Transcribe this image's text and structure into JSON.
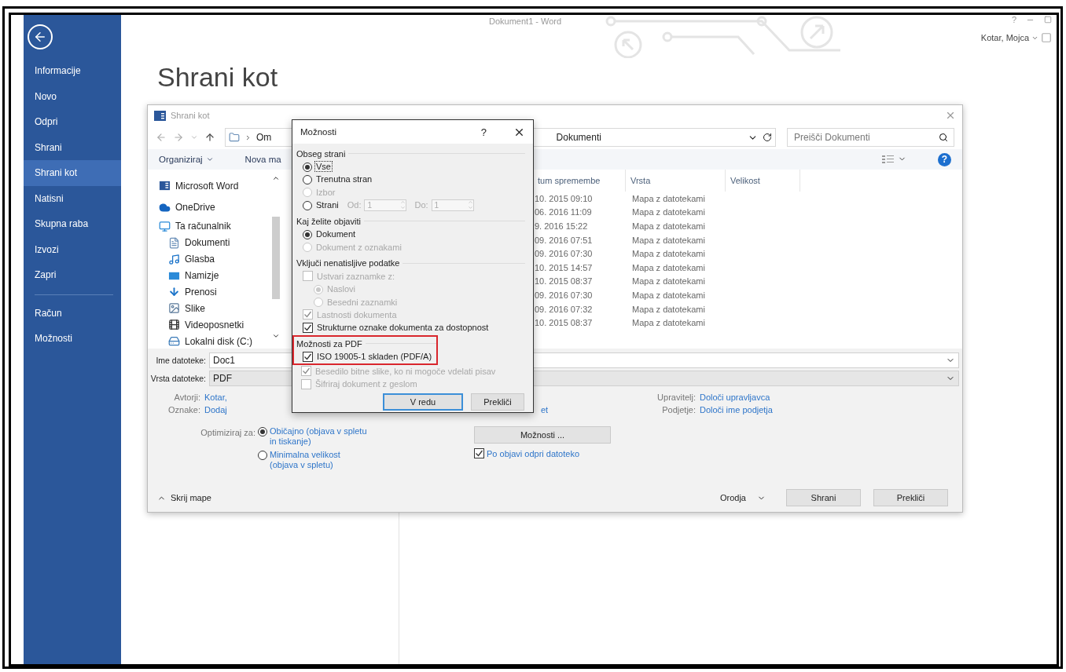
{
  "window": {
    "title": "Dokument1 - Word",
    "help": "?",
    "account": "Kotar, Mojca"
  },
  "backstage_nav": {
    "sections": [
      {
        "items": [
          {
            "label": "Informacije",
            "selected": false
          },
          {
            "label": "Novo",
            "selected": false
          },
          {
            "label": "Odpri",
            "selected": false
          },
          {
            "label": "Shrani",
            "selected": false
          },
          {
            "label": "Shrani kot",
            "selected": true
          },
          {
            "label": "Natisni",
            "selected": false
          },
          {
            "label": "Skupna raba",
            "selected": false
          },
          {
            "label": "Izvozi",
            "selected": false
          },
          {
            "label": "Zapri",
            "selected": false
          }
        ]
      },
      {
        "items": [
          {
            "label": "Račun",
            "selected": false
          },
          {
            "label": "Možnosti",
            "selected": false
          }
        ]
      }
    ]
  },
  "heading": "Shrani kot",
  "save_dialog": {
    "title": "Shrani kot",
    "breadcrumb": [
      "Om",
      "Dokumenti"
    ],
    "search": {
      "placeholder": "Preišči Dokumenti"
    },
    "toolbar": {
      "organize": "Organiziraj",
      "new_folder": "Nova ma",
      "help": "?"
    },
    "nav_pane": [
      {
        "label": "Microsoft Word"
      },
      {
        "label": "OneDrive"
      },
      {
        "label": "Ta računalnik",
        "children": [
          {
            "label": "Dokumenti"
          },
          {
            "label": "Glasba"
          },
          {
            "label": "Namizje"
          },
          {
            "label": "Prenosi"
          },
          {
            "label": "Slike"
          },
          {
            "label": "Videoposnetki"
          },
          {
            "label": "Lokalni disk (C:)"
          }
        ]
      }
    ],
    "columns": [
      "tum spremembe",
      "Vrsta",
      "Velikost"
    ],
    "rows": [
      {
        "date": "10. 2015 09:10",
        "type": "Mapa z datotekami"
      },
      {
        "date": "06. 2016 11:09",
        "type": "Mapa z datotekami"
      },
      {
        "date": "9. 2016 15:22",
        "type": "Mapa z datotekami"
      },
      {
        "date": "09. 2016 07:51",
        "type": "Mapa z datotekami"
      },
      {
        "date": "09. 2016 07:30",
        "type": "Mapa z datotekami"
      },
      {
        "date": "10. 2015 14:57",
        "type": "Mapa z datotekami"
      },
      {
        "date": "10. 2015 08:37",
        "type": "Mapa z datotekami"
      },
      {
        "date": "09. 2016 07:30",
        "type": "Mapa z datotekami"
      },
      {
        "date": "09. 2016 07:32",
        "type": "Mapa z datotekami"
      },
      {
        "date": "10. 2015 08:37",
        "type": "Mapa z datotekami"
      }
    ],
    "file_name": {
      "label": "Ime datoteke:",
      "value": "Doc1"
    },
    "file_type": {
      "label": "Vrsta datoteke:",
      "value": "PDF"
    },
    "meta_left": [
      {
        "label": "Avtorji:",
        "value": "Kotar,"
      },
      {
        "label": "Oznake:",
        "value": "Dodaj"
      }
    ],
    "meta_middle": "et",
    "meta_right": [
      {
        "label": "Upravitelj:",
        "value": "Določi upravljavca"
      },
      {
        "label": "Podjetje:",
        "value": "Določi ime podjetja"
      }
    ],
    "optimize": {
      "label": "Optimiziraj za:",
      "options": [
        {
          "label": "Običajno (objava v spletu in tiskanje)",
          "selected": true
        },
        {
          "label": "Minimalna velikost (objava v spletu)",
          "selected": false
        }
      ]
    },
    "options_button": "Možnosti ...",
    "open_after": {
      "label": "Po objavi odpri datoteko",
      "checked": true
    },
    "hide_folders": "Skrij mape",
    "tools": "Orodja",
    "buttons": [
      "Shrani",
      "Prekliči"
    ]
  },
  "options_dialog": {
    "title": "Možnosti",
    "help": "?",
    "groups": [
      {
        "title": "Obseg strani",
        "highlighted": false,
        "items": [
          {
            "kind": "radio",
            "label": "Vse",
            "selected": true,
            "disabled": false,
            "focused": true
          },
          {
            "kind": "radio",
            "label": "Trenutna stran",
            "selected": false,
            "disabled": false,
            "focused": false
          },
          {
            "kind": "radio",
            "label": "Izbor",
            "selected": false,
            "disabled": true,
            "focused": false
          },
          {
            "kind": "range",
            "label": "Strani",
            "selected": false,
            "disabled": false,
            "focused": false,
            "from_label": "Od:",
            "from": "1",
            "to_label": "Do:",
            "to": "1"
          }
        ]
      },
      {
        "title": "Kaj želite objaviti",
        "highlighted": false,
        "items": [
          {
            "kind": "radio",
            "label": "Dokument",
            "selected": true,
            "disabled": false,
            "focused": false
          },
          {
            "kind": "radio",
            "label": "Dokument z oznakami",
            "selected": false,
            "disabled": true,
            "focused": false
          }
        ]
      },
      {
        "title": "Vključi nenatisljive podatke",
        "highlighted": false,
        "items": [
          {
            "kind": "checkbox",
            "label": "Ustvari zaznamke z:",
            "checked": false,
            "disabled": true,
            "children": [
              {
                "kind": "radio",
                "label": "Naslovi",
                "selected": true,
                "disabled": true,
                "focused": false
              },
              {
                "kind": "radio",
                "label": "Besedni zaznamki",
                "selected": false,
                "disabled": true,
                "focused": false
              }
            ]
          },
          {
            "kind": "checkbox",
            "label": "Lastnosti dokumenta",
            "checked": true,
            "disabled": true
          },
          {
            "kind": "checkbox",
            "label": "Strukturne oznake dokumenta za dostopnost",
            "checked": true,
            "disabled": false
          }
        ]
      },
      {
        "title": "Možnosti za PDF",
        "highlighted": true,
        "items": [
          {
            "kind": "checkbox",
            "label": "ISO 19005-1 skladen (PDF/A)",
            "checked": true,
            "disabled": false
          },
          {
            "kind": "checkbox",
            "label": "Besedilo bitne slike, ko ni mogoče vdelati pisav",
            "checked": true,
            "disabled": true
          },
          {
            "kind": "checkbox",
            "label": "Šifriraj dokument z geslom",
            "checked": false,
            "disabled": true
          }
        ]
      }
    ],
    "buttons": [
      {
        "label": "V redu",
        "default": true
      },
      {
        "label": "Prekliči",
        "default": false
      }
    ]
  }
}
